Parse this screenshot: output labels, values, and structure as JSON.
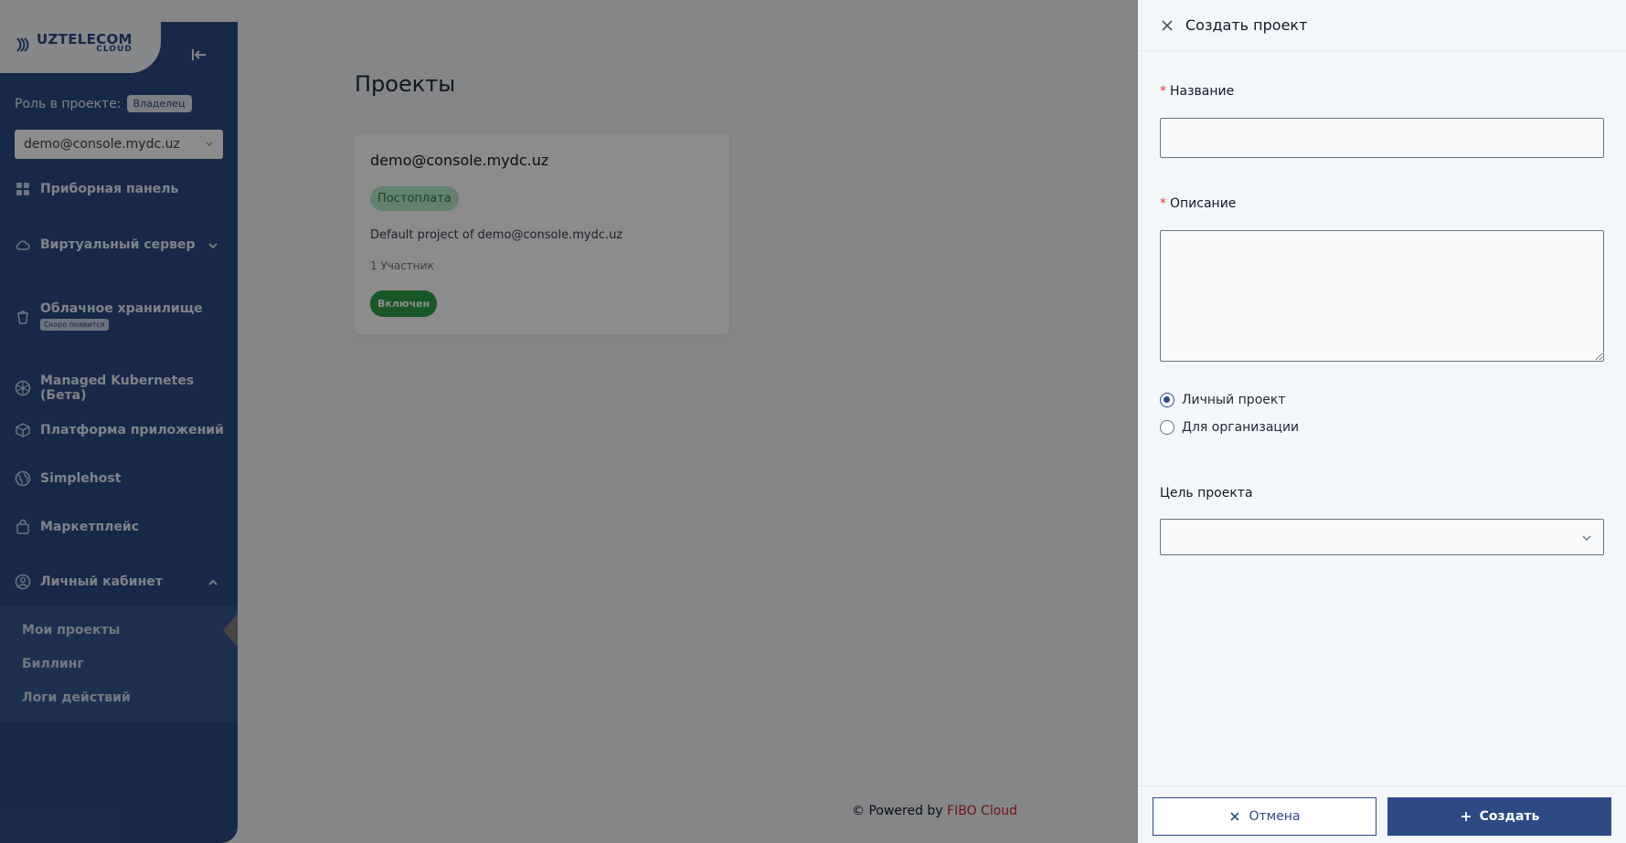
{
  "sidebar": {
    "logo_brand": "UZTELECOM",
    "logo_sub": "CLOUD",
    "role_label": "Роль в проекте:",
    "role_value": "Владелец",
    "project_select_value": "demo@console.mydc.uz",
    "items": [
      {
        "label": "Приборная панель",
        "icon": "grid-icon"
      },
      {
        "label": "Виртуальный сервер",
        "icon": "cloud-icon"
      },
      {
        "label": "Облачное хранилище",
        "icon": "bucket-icon",
        "badge": "Скоро появится"
      },
      {
        "label": "Managed Kubernetes (Бета)",
        "icon": "kubernetes-icon"
      },
      {
        "label": "Платформа приложений",
        "icon": "box-icon"
      },
      {
        "label": "Simplehost",
        "icon": "globe-icon"
      },
      {
        "label": "Маркетплейс",
        "icon": "bag-icon"
      },
      {
        "label": "Личный кабинет",
        "icon": "user-icon"
      }
    ],
    "subitems": [
      "Мои проекты",
      "Биллинг",
      "Логи действий"
    ]
  },
  "main": {
    "title": "Проекты",
    "card": {
      "title": "demo@console.mydc.uz",
      "badge": "Постоплата",
      "description": "Default project of demo@console.mydc.uz",
      "members": "1 Участник",
      "status": "Включен"
    },
    "footer_prefix": "© Powered by ",
    "footer_brand": "FIBO Cloud"
  },
  "drawer": {
    "title": "Создать проект",
    "name_label": "Название",
    "name_value": "",
    "description_label": "Описание",
    "description_value": "",
    "radio_personal": "Личный проект",
    "radio_org": "Для организации",
    "goal_label": "Цель проекта",
    "goal_value": "",
    "cancel_label": "Отмена",
    "create_label": "Создать"
  },
  "colors": {
    "brand": "#2d4a84",
    "required": "#e53935",
    "status_green": "#2f9e48",
    "footer_brand": "#c62828"
  }
}
